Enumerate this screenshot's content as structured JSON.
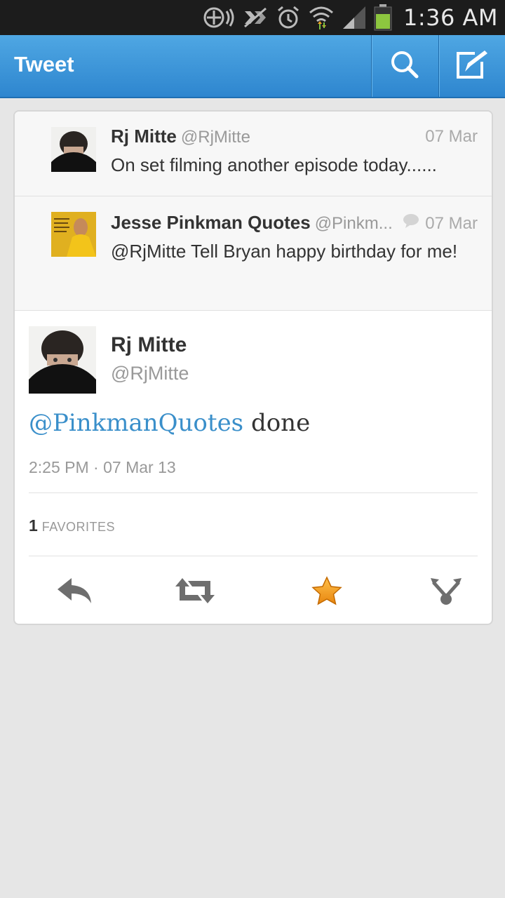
{
  "status_bar": {
    "time": "1:36 AM",
    "icons": [
      "nfc-icon",
      "data-blocked-icon",
      "alarm-icon",
      "wifi-icon",
      "signal-icon",
      "battery-icon"
    ]
  },
  "action_bar": {
    "title": "Tweet",
    "buttons": [
      "search-icon",
      "compose-icon"
    ]
  },
  "context_tweets": [
    {
      "name": "Rj Mitte",
      "handle": "@RjMitte",
      "date": "07 Mar",
      "text": "On set filming another episode today......"
    },
    {
      "name": "Jesse Pinkman Quotes",
      "handle": "@Pinkm...",
      "date": "07 Mar",
      "text": "@RjMitte Tell Bryan happy birthday for me!"
    }
  ],
  "main_tweet": {
    "name": "Rj Mitte",
    "handle": "@RjMitte",
    "mention": "@PinkmanQuotes",
    "text": " done",
    "timestamp": "2:25 PM · 07 Mar 13",
    "favorites_count": "1",
    "favorites_label": "FAVORITES",
    "favorited": true
  },
  "actions": [
    "reply-icon",
    "retweet-icon",
    "favorite-icon",
    "share-icon"
  ],
  "colors": {
    "action_bar": "#2e86cf",
    "mention": "#3a8fca",
    "favorite_star": "#f5a623"
  }
}
